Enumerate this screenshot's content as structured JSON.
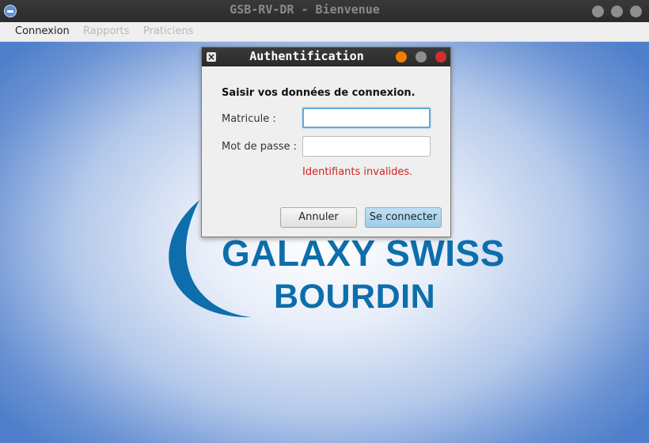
{
  "window": {
    "title": "GSB-RV-DR - Bienvenue",
    "app_icon": "app-logo-icon",
    "controls": [
      "minimize-icon",
      "maximize-icon",
      "close-icon"
    ]
  },
  "menubar": {
    "items": [
      {
        "label": "Connexion",
        "enabled": true
      },
      {
        "label": "Rapports",
        "enabled": false
      },
      {
        "label": "Praticiens",
        "enabled": false
      }
    ]
  },
  "background_logo": {
    "line1": "GALAXY SWISS",
    "line2": "BOURDIN",
    "color": "#0d6eab"
  },
  "dialog": {
    "title": "Authentification",
    "prompt": "Saisir vos données de connexion.",
    "matricule_label": "Matricule :",
    "matricule_value": "",
    "password_label": "Mot de passe :",
    "password_value": "",
    "error_text": "Identifiants invalides.",
    "error_color": "#d42121",
    "cancel_label": "Annuler",
    "connect_label": "Se connecter",
    "titlebar_dots": {
      "orange": "#f57c00",
      "gray": "#8e8e8e",
      "red": "#d32f2f"
    }
  }
}
